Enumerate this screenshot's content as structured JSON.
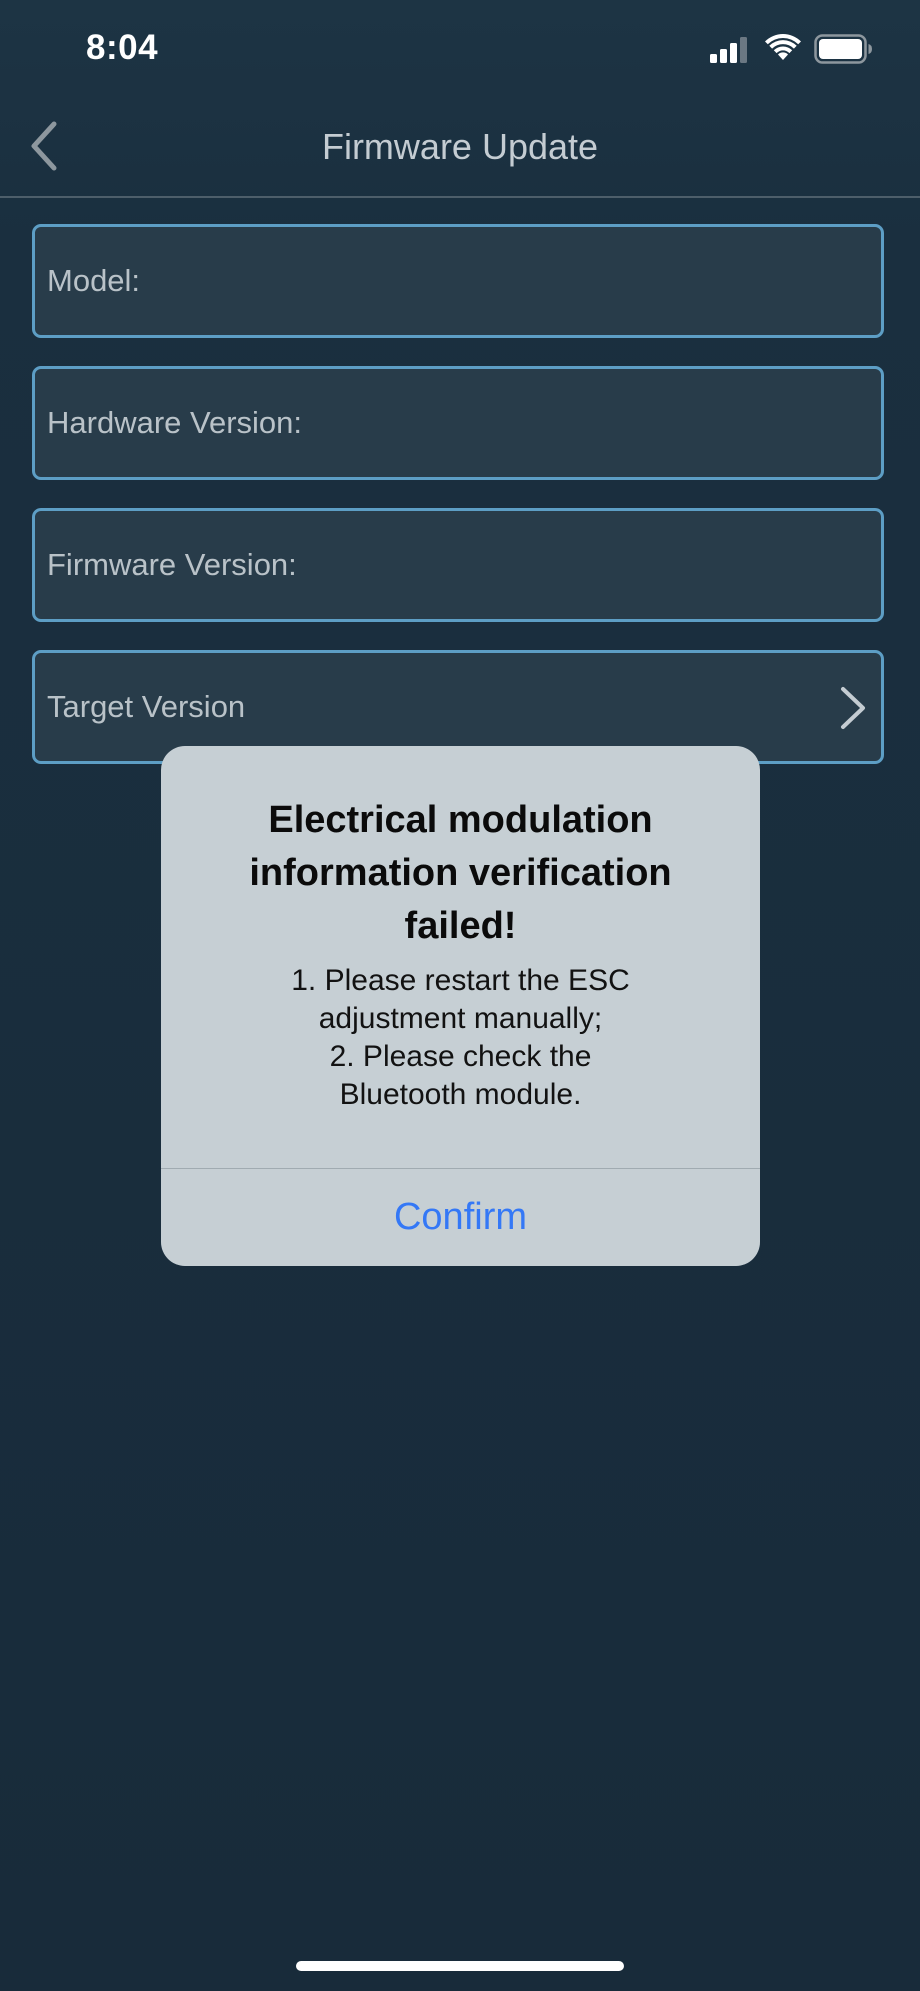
{
  "status_bar": {
    "time": "8:04",
    "icons": [
      "cellular-signal-icon",
      "wifi-icon",
      "battery-icon"
    ]
  },
  "nav": {
    "title": "Firmware Update",
    "back_icon": "chevron-left-icon"
  },
  "fields": {
    "model_label": "Model:",
    "hardware_label": "Hardware Version:",
    "firmware_label": "Firmware Version:",
    "target_label": "Target Version",
    "target_icon": "chevron-right-icon"
  },
  "alert": {
    "title": "Electrical modulation information verification failed!",
    "message_lines": [
      "1. Please restart the ESC",
      "adjustment manually;",
      "2. Please check the",
      "Bluetooth module."
    ],
    "confirm_label": "Confirm"
  },
  "colors": {
    "background": "#182c3b",
    "field_border": "#5d9ec5",
    "field_fill": "#283c4a",
    "alert_background": "#c6cfd4",
    "accent_blue": "#3478f6"
  }
}
